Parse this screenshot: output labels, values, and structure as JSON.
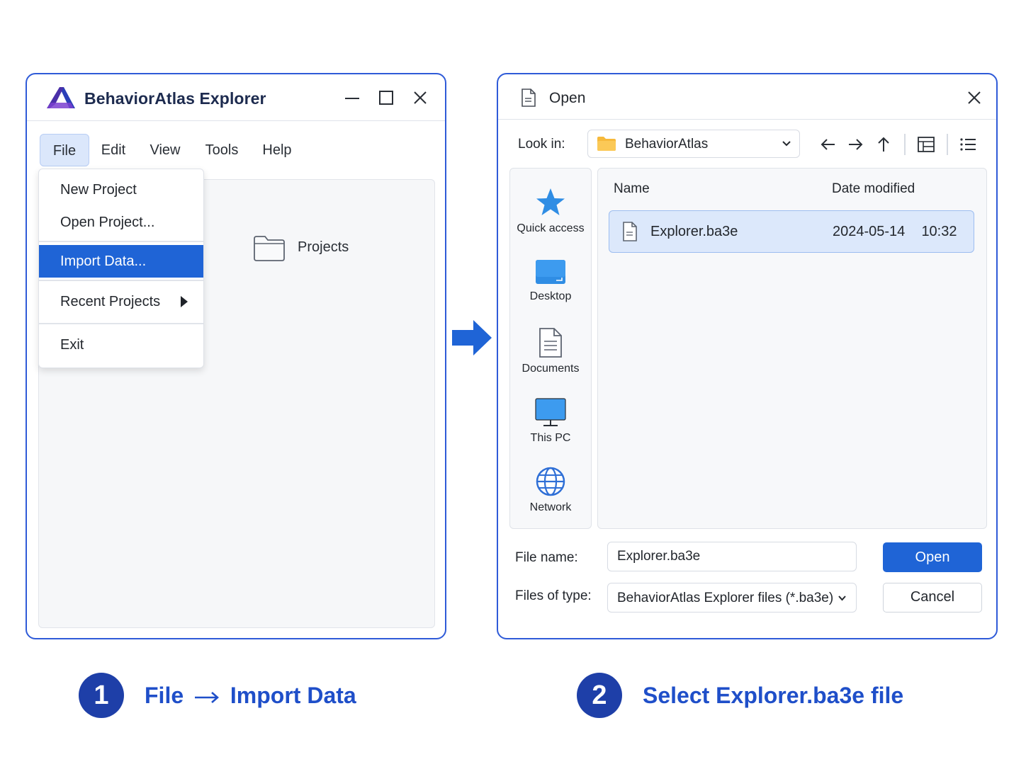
{
  "colors": {
    "accent": "#1f64d6",
    "window_border": "#2f5bd8",
    "step_circle": "#1e3fa8",
    "step_text": "#1f4fc9",
    "folder": "#f6b93b"
  },
  "main_window": {
    "title": "BehaviorAtlas Explorer",
    "menu": [
      "File",
      "Edit",
      "View",
      "Tools",
      "Help"
    ],
    "active_menu": "File",
    "file_menu": {
      "items": [
        "New Project",
        "Open Project...",
        "Import Data...",
        "Recent Projects",
        "Exit"
      ],
      "selected": "Import Data..."
    },
    "workspace_folder": "Projects"
  },
  "open_dialog": {
    "title": "Open",
    "look_in_label": "Look in:",
    "look_in_value": "BehaviorAtlas",
    "places": [
      "Quick access",
      "Desktop",
      "Documents",
      "This PC",
      "Network"
    ],
    "columns": [
      "Name",
      "Date modified"
    ],
    "files": [
      {
        "name": "Explorer.ba3e",
        "date": "2024-05-14",
        "time": "10:32",
        "selected": true
      }
    ],
    "file_name_label": "File name:",
    "file_name_value": "Explorer.ba3e",
    "file_type_label": "Files of type:",
    "file_type_value": "BehaviorAtlas Explorer files (*.ba3e)",
    "open_button": "Open",
    "cancel_button": "Cancel"
  },
  "steps": [
    {
      "number": "1",
      "part1": "File",
      "part2": "Import Data"
    },
    {
      "number": "2",
      "text": "Select Explorer.ba3e file"
    }
  ],
  "icons": [
    "app-logo-icon",
    "minimize-icon",
    "maximize-icon",
    "close-icon",
    "folder-icon",
    "submenu-arrow-icon",
    "right-arrow-icon",
    "document-icon",
    "chevron-down-icon",
    "back-icon",
    "forward-icon",
    "up-icon",
    "grid-view-icon",
    "list-view-icon",
    "star-icon",
    "desktop-icon",
    "this-pc-icon",
    "globe-icon",
    "file-icon"
  ]
}
